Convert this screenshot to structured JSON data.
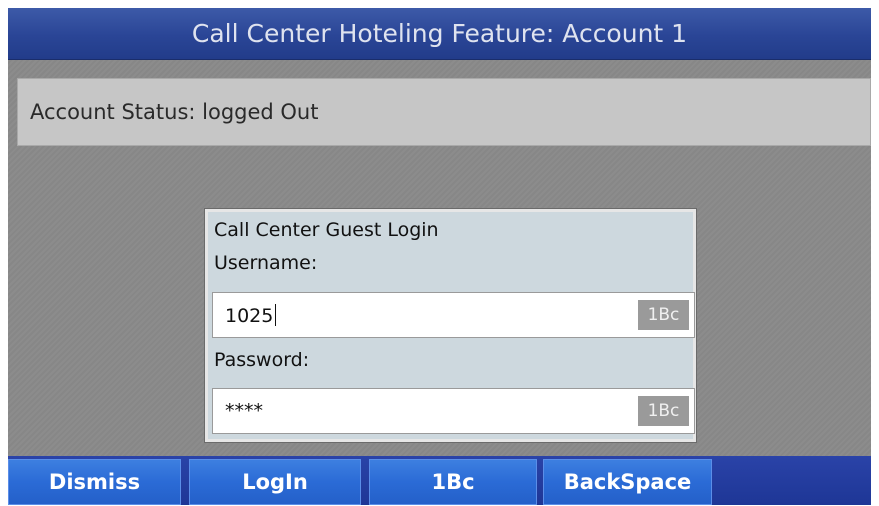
{
  "window": {
    "title": "Call Center Hoteling Feature: Account  1"
  },
  "status": {
    "text": "Account Status: logged Out"
  },
  "dialog": {
    "title": "Call Center Guest Login",
    "username_label": "Username:",
    "username_value": "1025",
    "username_mode": "1Bc",
    "password_label": "Password:",
    "password_value": "****",
    "password_mode": "1Bc"
  },
  "softkeys": [
    {
      "label": "Dismiss"
    },
    {
      "label": "LogIn"
    },
    {
      "label": "1Bc"
    },
    {
      "label": "BackSpace"
    }
  ],
  "colors": {
    "title_bar": "#2a4596",
    "softkey": "#2b6bd6",
    "dialog": "#cdd8de"
  }
}
